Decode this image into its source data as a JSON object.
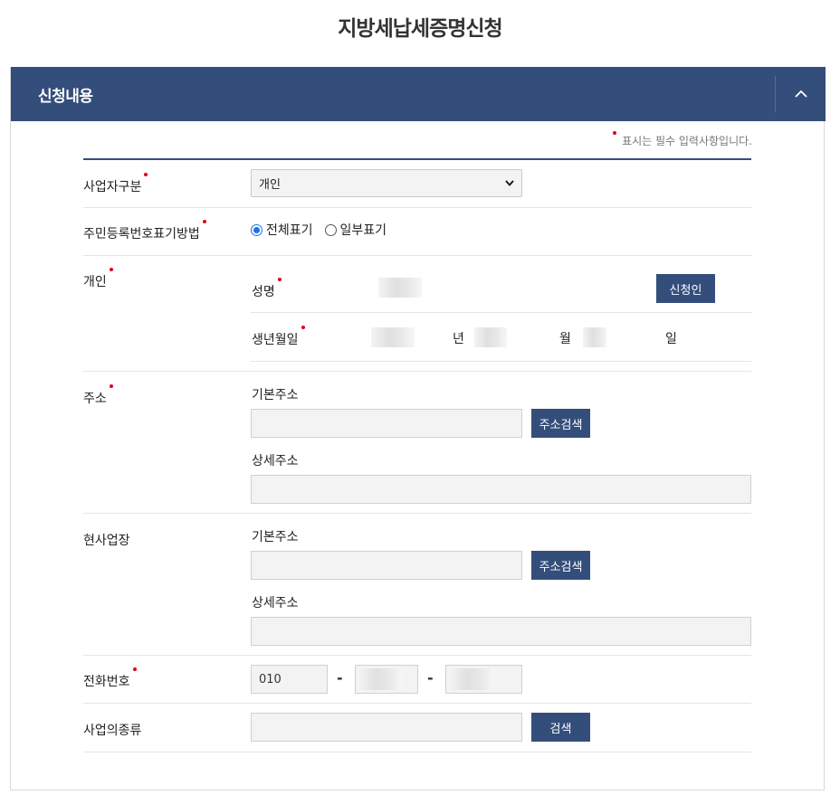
{
  "page": {
    "title": "지방세납세증명신청"
  },
  "panel": {
    "title": "신청내용",
    "toggle_icon": "chevron-up-icon"
  },
  "required_note": "표시는 필수 입력사항입니다.",
  "fields": {
    "business_type": {
      "label": "사업자구분",
      "selected": "개인"
    },
    "id_display": {
      "label": "주민등록번호표기방법",
      "options": [
        "전체표기",
        "일부표기"
      ],
      "selected": "전체표기"
    },
    "individual": {
      "label": "개인",
      "name_label": "성명",
      "applicant_button": "신청인",
      "birth_label": "생년월일",
      "year_unit": "년",
      "month_unit": "월",
      "day_unit": "일"
    },
    "address": {
      "label": "주소",
      "basic_label": "기본주소",
      "search_button": "주소검색",
      "detail_label": "상세주소"
    },
    "business_site": {
      "label": "현사업장",
      "basic_label": "기본주소",
      "search_button": "주소검색",
      "detail_label": "상세주소"
    },
    "phone": {
      "label": "전화번호",
      "prefix": "010",
      "separator": "-"
    },
    "business_kind": {
      "label": "사업의종류",
      "search_button": "검색"
    }
  },
  "colors": {
    "primary": "#344e7b",
    "required": "#e0001b",
    "rule": "#e5e5e5"
  }
}
